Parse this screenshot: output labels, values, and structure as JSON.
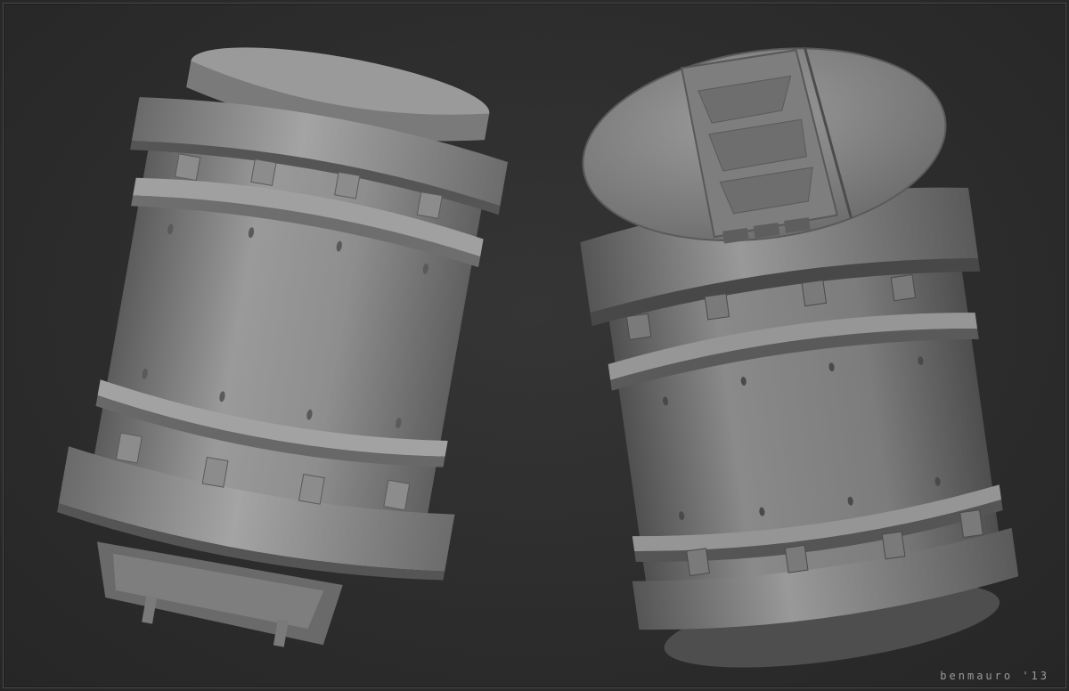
{
  "render": {
    "background_color": "#2d2d2d",
    "material_color": "#8a8a8a",
    "frame_color": "#4a4a4a",
    "objects": [
      "barrel-left",
      "barrel-right"
    ]
  },
  "signature": {
    "text": "benmauro '13"
  }
}
